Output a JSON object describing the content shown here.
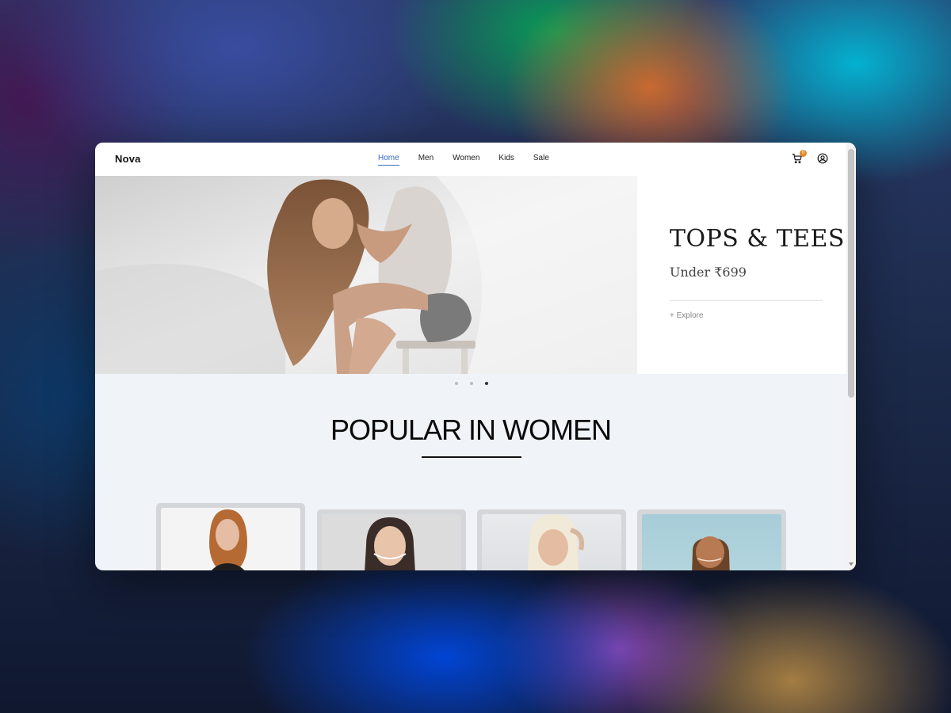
{
  "nav": {
    "logo": "Nova",
    "links": [
      {
        "label": "Home",
        "active": true
      },
      {
        "label": "Men",
        "active": false
      },
      {
        "label": "Women",
        "active": false
      },
      {
        "label": "Kids",
        "active": false
      },
      {
        "label": "Sale",
        "active": false
      }
    ],
    "cart": {
      "icon": "cart-icon",
      "count": "0"
    },
    "account": {
      "icon": "user-circle-icon"
    }
  },
  "hero": {
    "title": "TOPS & TEES",
    "subtitle": "Under ₹699",
    "cta": "+ Explore",
    "slides": 3,
    "active_slide": 3
  },
  "section": {
    "title": "POPULAR IN WOMEN"
  },
  "products": [
    {
      "name": "product-1"
    },
    {
      "name": "product-2"
    },
    {
      "name": "product-3"
    },
    {
      "name": "product-4"
    }
  ],
  "colors": {
    "accent": "#3a6bc8",
    "badge": "#e08a2a",
    "page_bg": "#f0f3f8"
  }
}
